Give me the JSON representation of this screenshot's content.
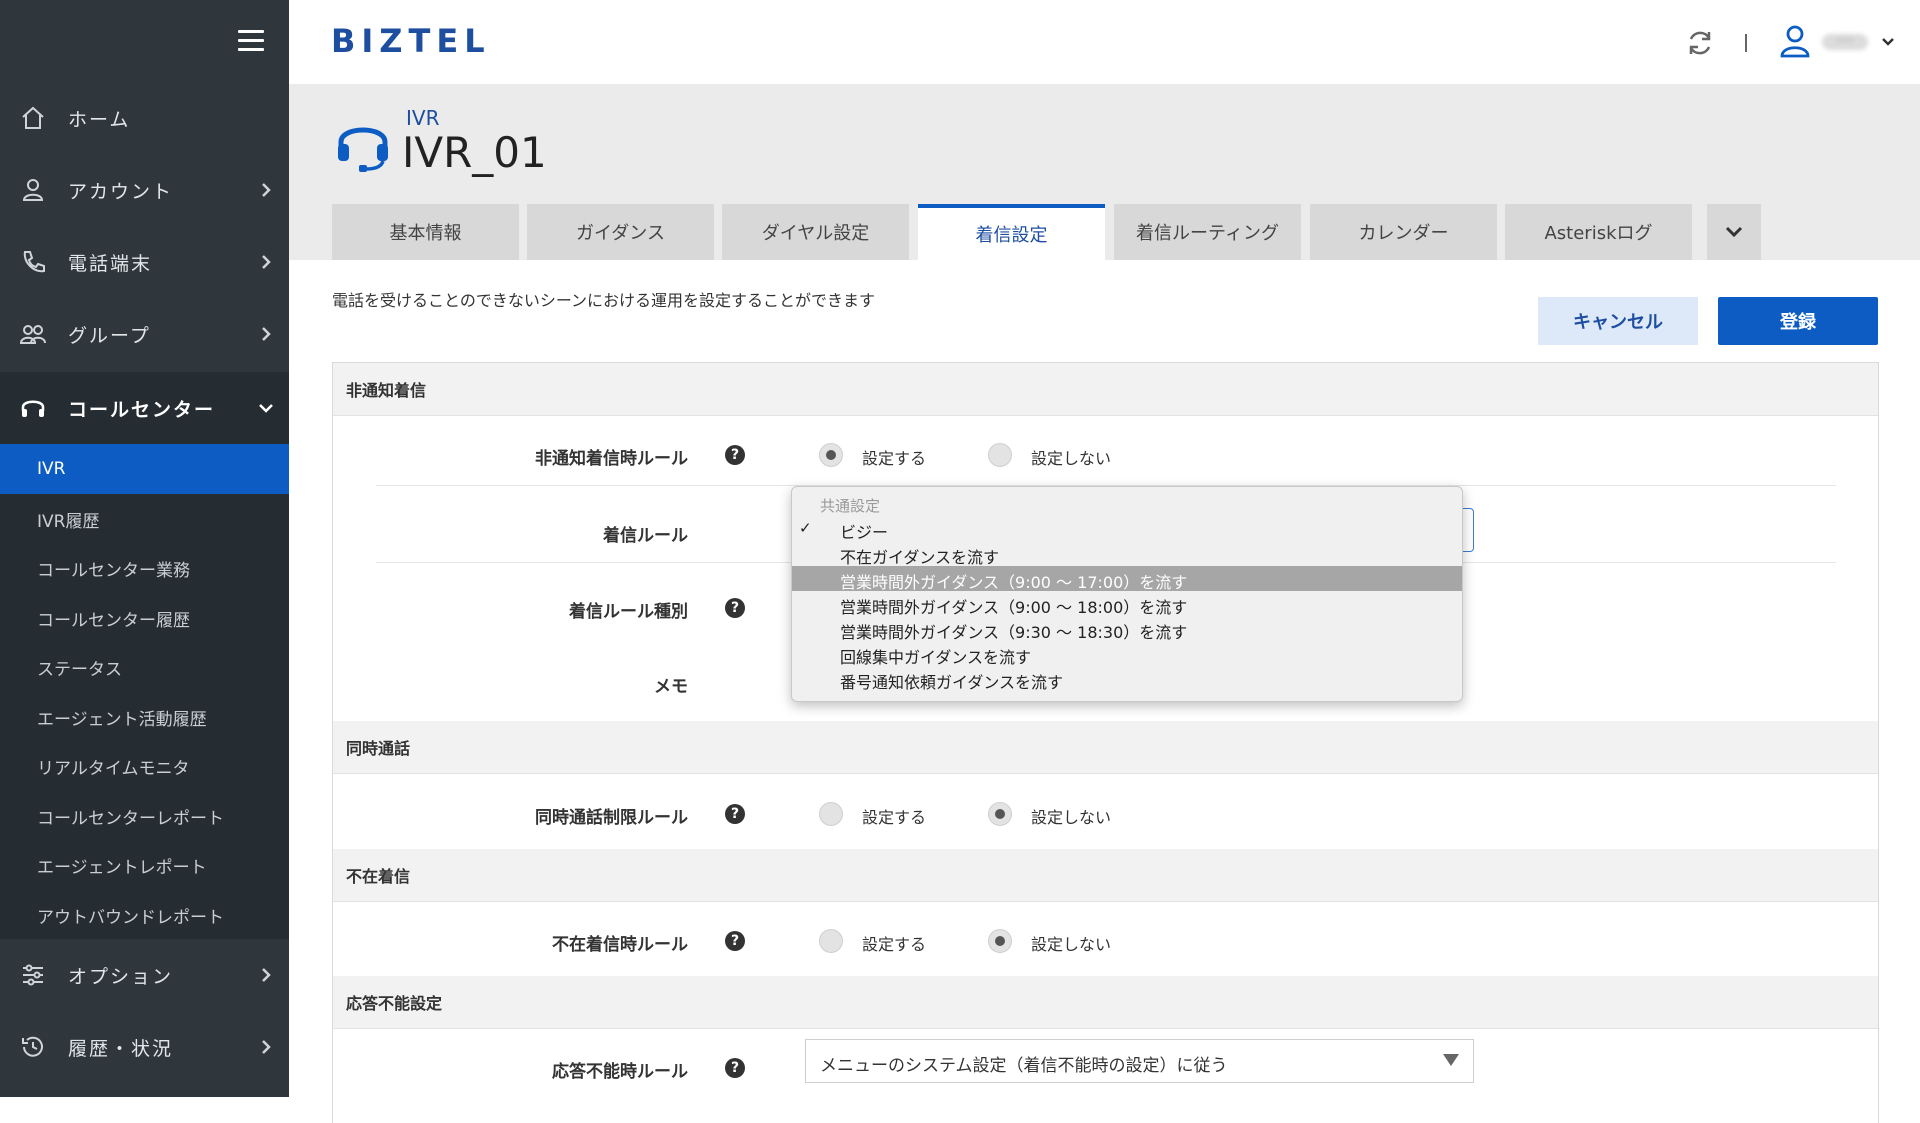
{
  "sidebar": {
    "items": [
      {
        "label": "ホーム",
        "icon": "home-icon"
      },
      {
        "label": "アカウント",
        "icon": "user-icon"
      },
      {
        "label": "電話端末",
        "icon": "phone-icon"
      },
      {
        "label": "グループ",
        "icon": "group-icon"
      },
      {
        "label": "コールセンター",
        "icon": "headset-icon"
      },
      {
        "label": "オプション",
        "icon": "sliders-icon"
      },
      {
        "label": "履歴・状況",
        "icon": "history-icon"
      }
    ],
    "callcenter_sub": [
      "IVR",
      "IVR履歴",
      "コールセンター業務",
      "コールセンター履歴",
      "ステータス",
      "エージェント活動履歴",
      "リアルタイムモニタ",
      "コールセンターレポート",
      "エージェントレポート",
      "アウトバウンドレポート"
    ]
  },
  "header": {
    "logo": "BIZTEL",
    "user_name": "***"
  },
  "page": {
    "category": "IVR",
    "title": "IVR_01",
    "tabs": [
      "基本情報",
      "ガイダンス",
      "ダイヤル設定",
      "着信設定",
      "着信ルーティング",
      "カレンダー",
      "Asteriskログ"
    ],
    "active_tab": "着信設定",
    "description": "電話を受けることのできないシーンにおける運用を設定することができます",
    "cancel_label": "キャンセル",
    "register_label": "登録"
  },
  "form": {
    "sections": {
      "anonymous": "非通知着信",
      "concurrent": "同時通話",
      "absent": "不在着信",
      "unavailable": "応答不能設定"
    },
    "rows": {
      "anonymous_rule": "非通知着信時ルール",
      "incoming_rule": "着信ルール",
      "incoming_rule_type": "着信ルール種別",
      "memo": "メモ",
      "concurrent_rule": "同時通話制限ルール",
      "absent_rule": "不在着信時ルール",
      "unavailable_rule": "応答不能時ルール"
    },
    "radio_on": "設定する",
    "radio_off": "設定しない",
    "help_glyph": "?",
    "unavailable_select_value": "メニューのシステム設定（着信不能時の設定）に従う"
  },
  "dropdown": {
    "group_label": "共通設定",
    "check_glyph": "✓",
    "options": [
      "ビジー",
      "不在ガイダンスを流す",
      "営業時間外ガイダンス（9:00 〜 17:00）を流す",
      "営業時間外ガイダンス（9:00 〜 18:00）を流す",
      "営業時間外ガイダンス（9:30 〜 18:30）を流す",
      "回線集中ガイダンスを流す",
      "番号通知依頼ガイダンスを流す"
    ],
    "selected": "ビジー",
    "highlighted": "営業時間外ガイダンス（9:00 〜 17:00）を流す"
  },
  "colors": {
    "sidebar_bg": "#2f373d",
    "accent": "#0c5cc4",
    "brand": "#1d4ea0",
    "title_band": "#ebebeb"
  }
}
